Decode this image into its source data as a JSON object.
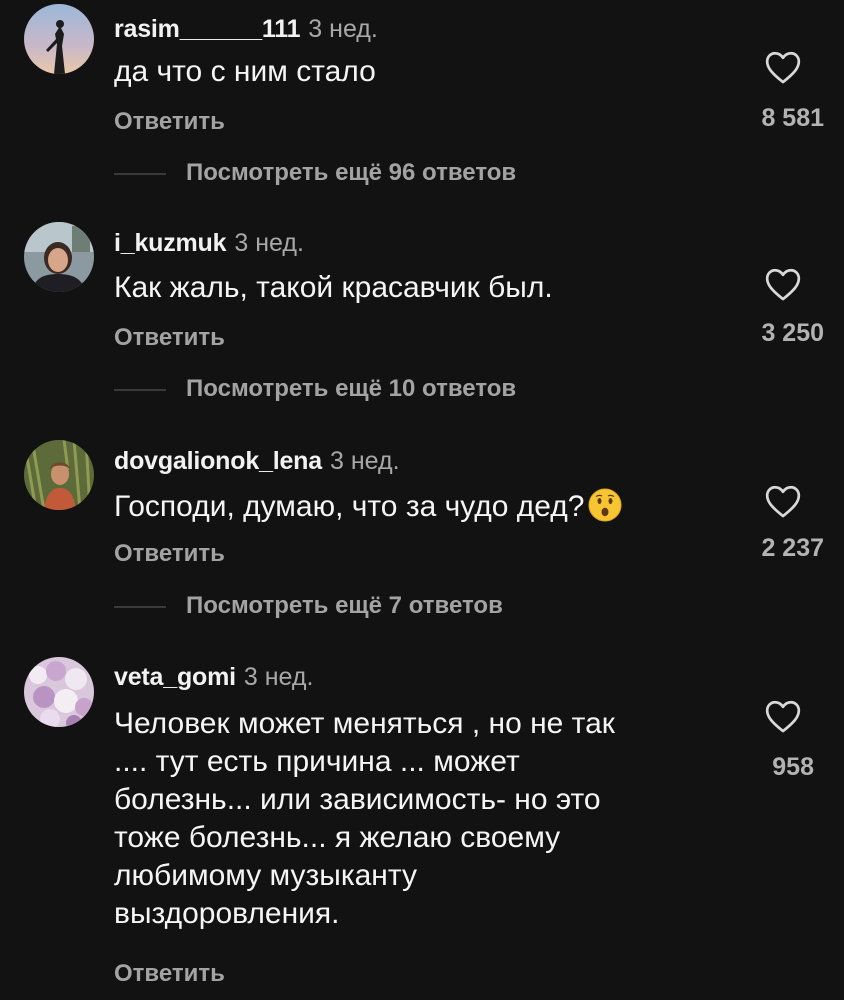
{
  "comments": [
    {
      "username": "rasim______111",
      "time": "3 нед.",
      "text": "да что с ним стало",
      "reply_label": "Ответить",
      "likes": "8 581",
      "more_replies": "Посмотреть ещё 96 ответов",
      "avatar_icon": "avatar-image"
    },
    {
      "username": "i_kuzmuk",
      "time": "3 нед.",
      "text": "Как жаль, такой красавчик был.",
      "reply_label": "Ответить",
      "likes": "3 250",
      "more_replies": "Посмотреть ещё 10 ответов",
      "avatar_icon": "avatar-image"
    },
    {
      "username": "dovgalionok_lena",
      "time": "3 нед.",
      "text": "Господи, думаю, что за чудо дед?",
      "emoji": "astonished-face-emoji",
      "reply_label": "Ответить",
      "likes": "2 237",
      "more_replies": "Посмотреть ещё 7 ответов",
      "avatar_icon": "avatar-image"
    },
    {
      "username": "veta_gomi",
      "time": "3 нед.",
      "text_lines": [
        "Человек может меняться , но не так",
        ".... тут есть причина ... может",
        "болезнь... или зависимость- но это",
        "тоже болезнь... я желаю своему",
        "любимому музыканту",
        "выздоровления."
      ],
      "reply_label": "Ответить",
      "likes": "958",
      "avatar_icon": "avatar-image"
    }
  ],
  "colors": {
    "background": "#121212",
    "primary_text": "#f5f5f5",
    "secondary_text": "#a3a3a3"
  },
  "icons": {
    "like": "heart-outline-icon"
  }
}
